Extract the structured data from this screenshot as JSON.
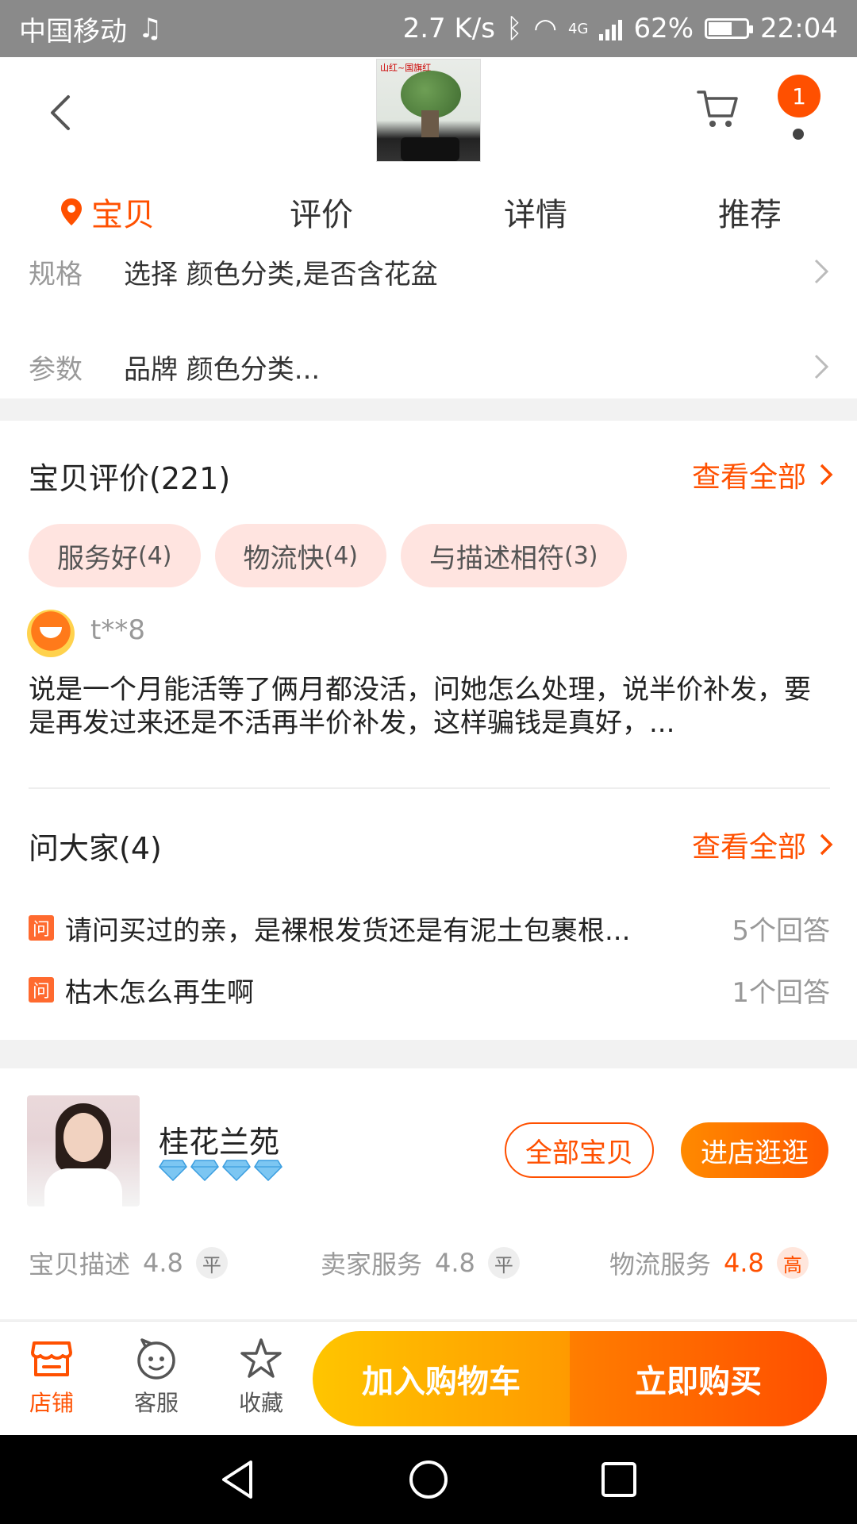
{
  "status_bar": {
    "carrier": "中国移动",
    "speed": "2.7 K/s",
    "network": "4G",
    "battery_pct": "62%",
    "battery_level": 0.62,
    "time": "22:04"
  },
  "header": {
    "thumb_tag": "山红~国旗红",
    "notification_count": "1",
    "tabs": [
      {
        "label": "宝贝",
        "active": true
      },
      {
        "label": "评价",
        "active": false
      },
      {
        "label": "详情",
        "active": false
      },
      {
        "label": "推荐",
        "active": false
      }
    ]
  },
  "spec": {
    "rows": [
      {
        "label": "规格",
        "value": "选择 颜色分类,是否含花盆"
      },
      {
        "label": "参数",
        "value": "品牌 颜色分类..."
      }
    ]
  },
  "reviews": {
    "title": "宝贝评价(221)",
    "view_all": "查看全部",
    "chips": [
      {
        "label": "服务好",
        "count": "(4)"
      },
      {
        "label": "物流快",
        "count": "(4)"
      },
      {
        "label": "与描述相符",
        "count": "(3)"
      }
    ],
    "reviewer": "t**8",
    "text": "说是一个月能活等了俩月都没活，问她怎么处理，说半价补发，要是再发过来还是不活再半价补发，这样骗钱是真好，..."
  },
  "qa": {
    "title": "问大家(4)",
    "view_all": "查看全部",
    "badge": "问",
    "items": [
      {
        "question": "请问买过的亲，是裸根发货还是有泥土包裹根...",
        "answers": "5个回答"
      },
      {
        "question": "枯木怎么再生啊",
        "answers": "1个回答"
      }
    ]
  },
  "shop": {
    "name": "桂花兰苑",
    "all_items": "全部宝贝",
    "enter_store": "进店逛逛",
    "ratings": [
      {
        "label": "宝贝描述",
        "score": "4.8",
        "level": "平",
        "high": false
      },
      {
        "label": "卖家服务",
        "score": "4.8",
        "level": "平",
        "high": false
      },
      {
        "label": "物流服务",
        "score": "4.8",
        "level": "高",
        "high": true
      }
    ]
  },
  "actions": {
    "store": "店铺",
    "service": "客服",
    "favorite": "收藏",
    "add_to_cart": "加入购物车",
    "buy_now": "立即购买"
  },
  "colors": {
    "accent": "#ff5000",
    "chip_bg": "#ffe4e0",
    "cart_gradient_start": "#ffc500",
    "buy_gradient_end": "#ff4e00"
  }
}
